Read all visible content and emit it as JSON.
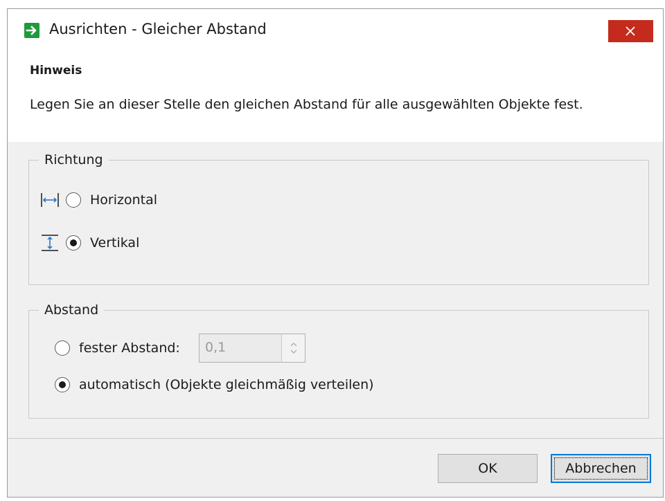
{
  "window": {
    "title": "Ausrichten - Gleicher Abstand",
    "app_icon": "green-arrow-right-icon",
    "close_icon": "close-icon",
    "accent_color": "#c42b1c"
  },
  "hint": {
    "title": "Hinweis",
    "text": "Legen Sie an dieser Stelle den gleichen Abstand für alle ausgewählten Objekte fest."
  },
  "direction": {
    "legend": "Richtung",
    "options": [
      {
        "label": "Horizontal",
        "icon": "horizontal-spacing-icon",
        "checked": false
      },
      {
        "label": "Vertikal",
        "icon": "vertical-spacing-icon",
        "checked": true
      }
    ]
  },
  "spacing": {
    "legend": "Abstand",
    "fixed": {
      "label": "fester Abstand:",
      "checked": false,
      "value": "0,1",
      "disabled": true
    },
    "auto": {
      "label": "automatisch (Objekte gleichmäßig verteilen)",
      "checked": true
    }
  },
  "buttons": {
    "ok": "OK",
    "cancel": "Abbrechen"
  }
}
